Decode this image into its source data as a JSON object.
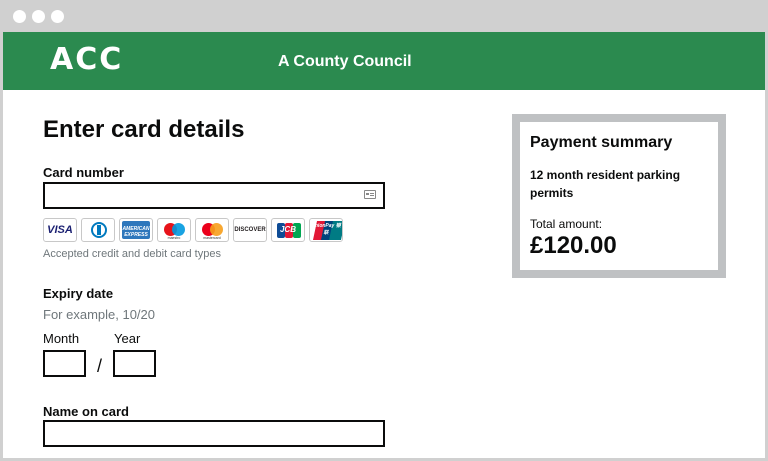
{
  "header": {
    "logo_text": "ACC",
    "council_name": "A County Council",
    "bg_color": "#2b8a4f"
  },
  "page": {
    "title": "Enter card details"
  },
  "card_number": {
    "label": "Card number",
    "value": "",
    "icon": "credit-card-icon"
  },
  "card_logos": [
    {
      "name": "visa",
      "text": "VISA"
    },
    {
      "name": "diners-club",
      "text": ""
    },
    {
      "name": "american-express",
      "text": "AMERICAN EXPRESS"
    },
    {
      "name": "maestro",
      "text": "maestro"
    },
    {
      "name": "mastercard",
      "text": "mastercard"
    },
    {
      "name": "discover",
      "text": "DISCOVER"
    },
    {
      "name": "jcb",
      "text": "JCB"
    },
    {
      "name": "unionpay",
      "text": "UnionPay 银联"
    }
  ],
  "accepted_hint": "Accepted credit and debit card types",
  "expiry": {
    "label": "Expiry date",
    "hint": "For example, 10/20",
    "month_label": "Month",
    "year_label": "Year",
    "month_value": "",
    "year_value": "",
    "separator": "/"
  },
  "name_on_card": {
    "label": "Name on card",
    "value": ""
  },
  "summary": {
    "title": "Payment summary",
    "item": "12 month resident parking permits",
    "total_label": "Total amount:",
    "total_amount": "£120.00"
  }
}
